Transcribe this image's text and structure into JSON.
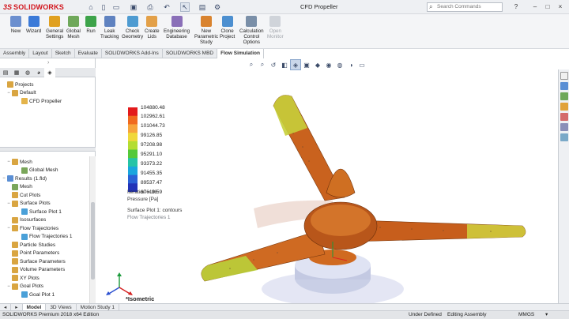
{
  "titlebar": {
    "app_name": "SOLIDWORKS",
    "document_title": "CFD Propeller",
    "search_placeholder": "Search Commands",
    "help_label": "?",
    "minimize": "–",
    "restore": "□",
    "close": "×"
  },
  "ribbon": {
    "buttons": [
      {
        "label": "New",
        "color": "#6b8fcf"
      },
      {
        "label": "Wizard",
        "color": "#3b7ad8"
      },
      {
        "label": "General\nSettings",
        "color": "#e0a020"
      },
      {
        "label": "Global\nMesh",
        "color": "#6fa85a"
      },
      {
        "label": "Run",
        "color": "#3da34a"
      },
      {
        "label": "Leak\nTracking",
        "color": "#5f82c0"
      },
      {
        "label": "Check\nGeometry",
        "color": "#4e9bd1"
      },
      {
        "label": "Create\nLids",
        "color": "#e3a048"
      },
      {
        "label": "Engineering\nDatabase",
        "color": "#8a6fb8"
      },
      {
        "label": "New\nParametric\nStudy",
        "color": "#d9832f"
      },
      {
        "label": "Clone\nProject",
        "color": "#4c8fd0"
      },
      {
        "label": "Calculation\nControl\nOptions",
        "color": "#7a8fa8"
      },
      {
        "label": "Open\nMonitor",
        "color": "#9aa3b0",
        "disabled": true
      }
    ]
  },
  "command_tabs": [
    "Assembly",
    "Layout",
    "Sketch",
    "Evaluate",
    "SOLIDWORKS Add-Ins",
    "SOLIDWORKS MBD",
    "Flow Simulation"
  ],
  "active_command_tab": "Flow Simulation",
  "tree_top": [
    {
      "label": "Projects",
      "indent": 0,
      "toggle": "",
      "icon": "#d9a541"
    },
    {
      "label": "Default",
      "indent": 1,
      "toggle": "−",
      "icon": "#d9a541"
    },
    {
      "label": "CFD Propeller",
      "indent": 3,
      "toggle": "",
      "icon": "#e4b44a"
    }
  ],
  "tree_bottom": [
    {
      "label": "Mesh",
      "indent": 1,
      "toggle": "−",
      "icon": "#d9a541"
    },
    {
      "label": "Global Mesh",
      "indent": 3,
      "toggle": "",
      "icon": "#7aa65a"
    },
    {
      "label": "Results (1.fld)",
      "indent": 0,
      "toggle": "−",
      "icon": "#5b8fd4"
    },
    {
      "label": "Mesh",
      "indent": 1,
      "toggle": "",
      "icon": "#7aa65a"
    },
    {
      "label": "Cut Plots",
      "indent": 1,
      "toggle": "",
      "icon": "#d9a541"
    },
    {
      "label": "Surface Plots",
      "indent": 1,
      "toggle": "−",
      "icon": "#d9a541"
    },
    {
      "label": "Surface Plot 1",
      "indent": 3,
      "toggle": "",
      "icon": "#4aa0d8"
    },
    {
      "label": "Isosurfaces",
      "indent": 1,
      "toggle": "",
      "icon": "#d9a541"
    },
    {
      "label": "Flow Trajectories",
      "indent": 1,
      "toggle": "−",
      "icon": "#d9a541"
    },
    {
      "label": "Flow Trajectories 1",
      "indent": 3,
      "toggle": "",
      "icon": "#4aa0d8"
    },
    {
      "label": "Particle Studies",
      "indent": 1,
      "toggle": "",
      "icon": "#d9a541"
    },
    {
      "label": "Point Parameters",
      "indent": 1,
      "toggle": "",
      "icon": "#d9a541"
    },
    {
      "label": "Surface Parameters",
      "indent": 1,
      "toggle": "",
      "icon": "#d9a541"
    },
    {
      "label": "Volume Parameters",
      "indent": 1,
      "toggle": "",
      "icon": "#d9a541"
    },
    {
      "label": "XY Plots",
      "indent": 1,
      "toggle": "",
      "icon": "#d9a541"
    },
    {
      "label": "Goal Plots",
      "indent": 1,
      "toggle": "−",
      "icon": "#d9a541"
    },
    {
      "label": "Goal Plot 1",
      "indent": 3,
      "toggle": "",
      "icon": "#4aa0d8"
    }
  ],
  "legend": {
    "values": [
      "104880.48",
      "102962.61",
      "101044.73",
      "99126.85",
      "97208.98",
      "95291.10",
      "93373.22",
      "91455.35",
      "89537.47",
      "87619.59"
    ],
    "colors": [
      "#e31a1c",
      "#f06a1f",
      "#f7a43c",
      "#f0d83a",
      "#b4dd32",
      "#55c93a",
      "#26c4a6",
      "#1aa6de",
      "#2a62d6",
      "#2233b8"
    ],
    "iteration": "Iteration = 88",
    "quantity": "Pressure [Pa]",
    "plot_name": "Surface Plot 1: contours",
    "trajectory_name": "Flow Trajectories 1"
  },
  "viewport": {
    "view_name": "*Isometric"
  },
  "bottom_tabs": [
    "Model",
    "3D Views",
    "Motion Study 1"
  ],
  "active_bottom_tab": "Model",
  "status": {
    "edition": "SOLIDWORKS Premium 2018 x64 Edition",
    "definition": "Under Defined",
    "mode": "Editing Assembly",
    "units": "MMGS"
  }
}
